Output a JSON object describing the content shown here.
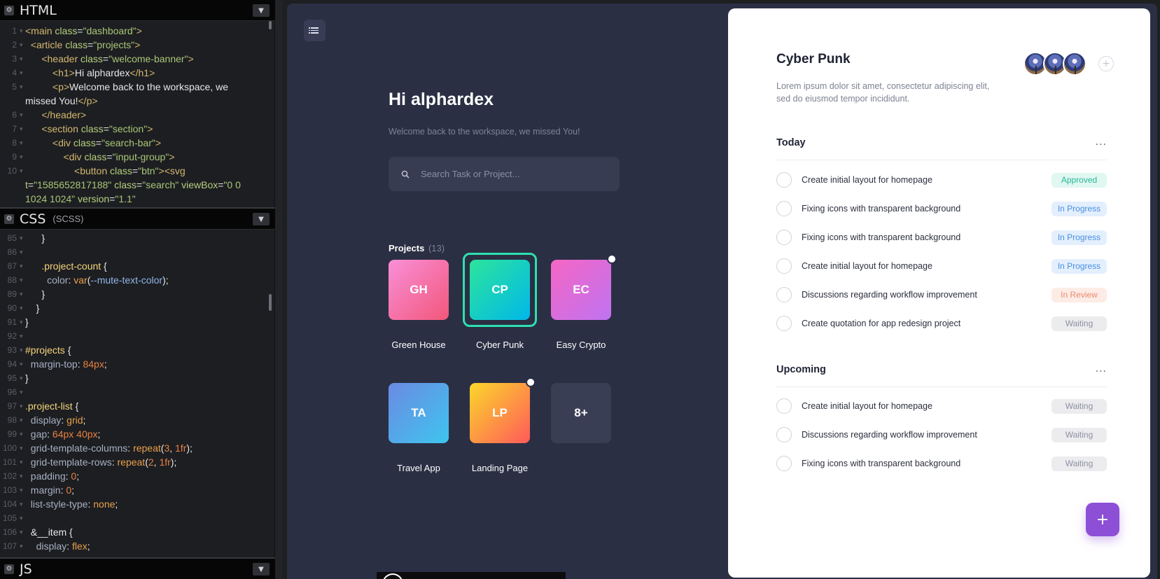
{
  "editors": {
    "html": {
      "name": "HTML",
      "lines": [
        {
          "n": "1",
          "html": "<span class=\"c-tag\">&lt;main</span> <span class=\"c-attr\">class</span>=<span class=\"c-str\">\"dashboard\"</span><span class=\"c-tag\">&gt;</span>"
        },
        {
          "n": "2",
          "html": "  <span class=\"c-tag\">&lt;article</span> <span class=\"c-attr\">class</span>=<span class=\"c-str\">\"projects\"</span><span class=\"c-tag\">&gt;</span>"
        },
        {
          "n": "3",
          "html": "      <span class=\"c-tag\">&lt;header</span> <span class=\"c-attr\">class</span>=<span class=\"c-str\">\"welcome-banner\"</span><span class=\"c-tag\">&gt;</span>"
        },
        {
          "n": "4",
          "html": "          <span class=\"c-tag\">&lt;h1&gt;</span>Hi alphardex<span class=\"c-tag\">&lt;/h1&gt;</span>"
        },
        {
          "n": "5",
          "html": "          <span class=\"c-tag\">&lt;p&gt;</span>Welcome back to the workspace, we missed You!<span class=\"c-tag\">&lt;/p&gt;</span>"
        },
        {
          "n": "6",
          "html": "      <span class=\"c-tag\">&lt;/header&gt;</span>"
        },
        {
          "n": "7",
          "html": "      <span class=\"c-tag\">&lt;section</span> <span class=\"c-attr\">class</span>=<span class=\"c-str\">\"section\"</span><span class=\"c-tag\">&gt;</span>"
        },
        {
          "n": "8",
          "html": "          <span class=\"c-tag\">&lt;div</span> <span class=\"c-attr\">class</span>=<span class=\"c-str\">\"search-bar\"</span><span class=\"c-tag\">&gt;</span>"
        },
        {
          "n": "9",
          "html": "              <span class=\"c-tag\">&lt;div</span> <span class=\"c-attr\">class</span>=<span class=\"c-str\">\"input-group\"</span><span class=\"c-tag\">&gt;</span>"
        },
        {
          "n": "10",
          "html": "                  <span class=\"c-tag\">&lt;button</span> <span class=\"c-attr\">class</span>=<span class=\"c-str\">\"btn\"</span><span class=\"c-tag\">&gt;</span><span class=\"c-tag\">&lt;svg</span> <span class=\"c-attr\">t</span>=<span class=\"c-str\">\"1585652817188\"</span> <span class=\"c-attr\">class</span>=<span class=\"c-str\">\"search\"</span> <span class=\"c-attr\">viewBox</span>=<span class=\"c-str\">\"0 0 1024 1024\"</span> <span class=\"c-attr\">version</span>=<span class=\"c-str\">\"1.1\"</span>"
        }
      ]
    },
    "css": {
      "name": "CSS",
      "sub": "(SCSS)",
      "lines": [
        {
          "n": "85",
          "html": "      }"
        },
        {
          "n": "86",
          "html": ""
        },
        {
          "n": "87",
          "html": "      <span class=\"c-sel\">.project-count</span> {"
        },
        {
          "n": "88",
          "html": "        <span class=\"c-prop\">color</span>: <span class=\"c-val\">var</span>(<span class=\"c-var\">--mute-text-color</span>);"
        },
        {
          "n": "89",
          "html": "      }"
        },
        {
          "n": "90",
          "html": "    }"
        },
        {
          "n": "91",
          "html": "}"
        },
        {
          "n": "92",
          "html": ""
        },
        {
          "n": "93",
          "html": "<span class=\"c-sel\">#projects</span> {"
        },
        {
          "n": "94",
          "html": "  <span class=\"c-prop\">margin-top</span>: <span class=\"c-num\">84px</span>;"
        },
        {
          "n": "95",
          "html": "}"
        },
        {
          "n": "96",
          "html": ""
        },
        {
          "n": "97",
          "html": "<span class=\"c-sel\">.project-list</span> {"
        },
        {
          "n": "98",
          "html": "  <span class=\"c-prop\">display</span>: <span class=\"c-val\">grid</span>;"
        },
        {
          "n": "99",
          "html": "  <span class=\"c-prop\">gap</span>: <span class=\"c-num\">64px 40px</span>;"
        },
        {
          "n": "100",
          "html": "  <span class=\"c-prop\">grid-template-columns</span>: <span class=\"c-val\">repeat</span>(<span class=\"c-num\">3</span>, <span class=\"c-num\">1fr</span>);"
        },
        {
          "n": "101",
          "html": "  <span class=\"c-prop\">grid-template-rows</span>: <span class=\"c-val\">repeat</span>(<span class=\"c-num\">2</span>, <span class=\"c-num\">1fr</span>);"
        },
        {
          "n": "102",
          "html": "  <span class=\"c-prop\">padding</span>: <span class=\"c-num\">0</span>;"
        },
        {
          "n": "103",
          "html": "  <span class=\"c-prop\">margin</span>: <span class=\"c-num\">0</span>;"
        },
        {
          "n": "104",
          "html": "  <span class=\"c-prop\">list-style-type</span>: <span class=\"c-val\">none</span>;"
        },
        {
          "n": "105",
          "html": ""
        },
        {
          "n": "106",
          "html": "  &amp;__item {"
        },
        {
          "n": "107",
          "html": "    <span class=\"c-prop\">display</span>: <span class=\"c-val\">flex</span>;"
        }
      ]
    },
    "js": {
      "name": "JS"
    }
  },
  "app": {
    "greeting": "Hi alphardex",
    "welcome_text": "Welcome back to the workspace, we missed You!",
    "search_placeholder": "Search Task or Project...",
    "projects_label": "Projects",
    "projects_count": "(13)",
    "projects": [
      {
        "abbr": "GH",
        "name": "Green House",
        "gradient": [
          "#f98fd8",
          "#f2577a"
        ],
        "dot": false,
        "active": false
      },
      {
        "abbr": "CP",
        "name": "Cyber Punk",
        "gradient": [
          "#2ce59b",
          "#01b7ea"
        ],
        "dot": false,
        "active": true
      },
      {
        "abbr": "EC",
        "name": "Easy Crypto",
        "gradient": [
          "#f566c4",
          "#bf73f2"
        ],
        "dot": true,
        "active": false
      },
      {
        "abbr": "TA",
        "name": "Travel App",
        "gradient": [
          "#6b8ae3",
          "#3ec5ee"
        ],
        "dot": false,
        "active": false
      },
      {
        "abbr": "LP",
        "name": "Landing Page",
        "gradient": [
          "#fbd72a",
          "#ff5a5a"
        ],
        "dot": true,
        "active": false
      },
      {
        "abbr": "8+",
        "name": "",
        "gradient": [
          "#3a3e54",
          "#3a3e54"
        ],
        "dot": false,
        "active": false
      }
    ]
  },
  "detail": {
    "title": "Cyber Punk",
    "description": "Lorem ipsum dolor sit amet, consectetur adipiscing elit, sed do eiusmod tempor incididunt.",
    "add_member": "+",
    "today_label": "Today",
    "upcoming_label": "Upcoming",
    "more": "...",
    "today": [
      {
        "text": "Create initial layout for homepage",
        "status": "Approved",
        "kind": "approved"
      },
      {
        "text": "Fixing icons with transparent background",
        "status": "In Progress",
        "kind": "progress"
      },
      {
        "text": "Fixing icons with transparent background",
        "status": "In Progress",
        "kind": "progress"
      },
      {
        "text": "Create initial layout for homepage",
        "status": "In Progress",
        "kind": "progress"
      },
      {
        "text": "Discussions regarding workflow improvement",
        "status": "In Review",
        "kind": "review"
      },
      {
        "text": "Create quotation for app redesign project",
        "status": "Waiting",
        "kind": "waiting"
      }
    ],
    "upcoming": [
      {
        "text": "Create initial layout for homepage",
        "status": "Waiting",
        "kind": "waiting"
      },
      {
        "text": "Discussions regarding workflow improvement",
        "status": "Waiting",
        "kind": "waiting"
      },
      {
        "text": "Fixing icons with transparent background",
        "status": "Waiting",
        "kind": "waiting"
      }
    ],
    "fab": "+"
  }
}
